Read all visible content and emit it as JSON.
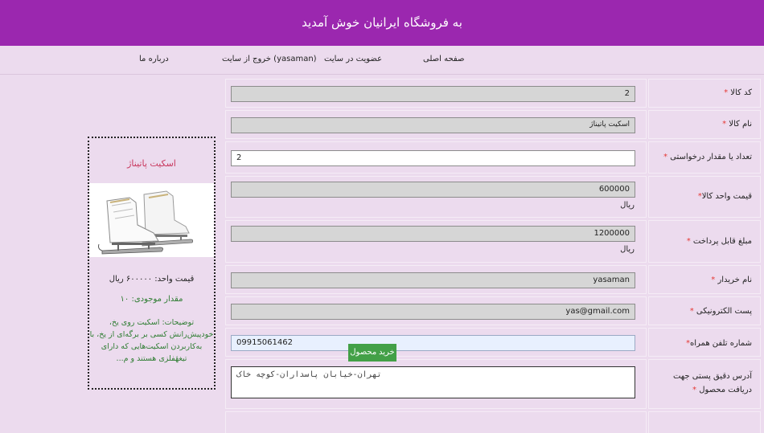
{
  "header": {
    "title": "به فروشگاه ایرانیان خوش آمدید"
  },
  "nav": {
    "home": "صفحه اصلی",
    "signup": "عضویت در سایت",
    "logout": "خروج از سایت (yasaman)",
    "about": "درباره ما"
  },
  "form": {
    "rows": [
      {
        "label": "کد کالا",
        "value": "2"
      },
      {
        "label": "نام کالا",
        "value": "اسکیت پاتیناژ"
      },
      {
        "label": "تعداد یا مقدار درخواستی",
        "value": "2"
      },
      {
        "label": "قیمت واحد کالا",
        "value": "600000",
        "unit": "ریال"
      },
      {
        "label": "مبلغ قابل پرداخت",
        "value": "1200000",
        "unit": "ریال"
      },
      {
        "label": "نام خریدار",
        "value": "yasaman"
      },
      {
        "label": "پست الکترونیکی",
        "value": "yas@gmail.com"
      },
      {
        "label": "شماره تلفن همراه",
        "value": "09915061462"
      },
      {
        "label": "آدرس دقیق پستی جهت دریافت محصول",
        "value": "تهران-خیابان پاسداران-کوچه خاک"
      }
    ],
    "required_mark": "*",
    "submit_label": "خرید محصول"
  },
  "product_card": {
    "title": "اسکیت پاتیناژ",
    "price": "قیمت واحد: ۶۰۰۰۰۰ ریال",
    "stock": "مقدار موجودی: ۱۰",
    "description": "توضیحات: اسکیت روی یخ، خودپیش‌رانش کسی بر برگه‌ای از یخ، با به‌کاربردن اسکیت‌هایی که دارای تیغهٔفلزی هستند و م..."
  },
  "colors": {
    "header": "#9b27af",
    "background": "#ecdbee",
    "button": "#43a047",
    "required": "#e53935"
  }
}
